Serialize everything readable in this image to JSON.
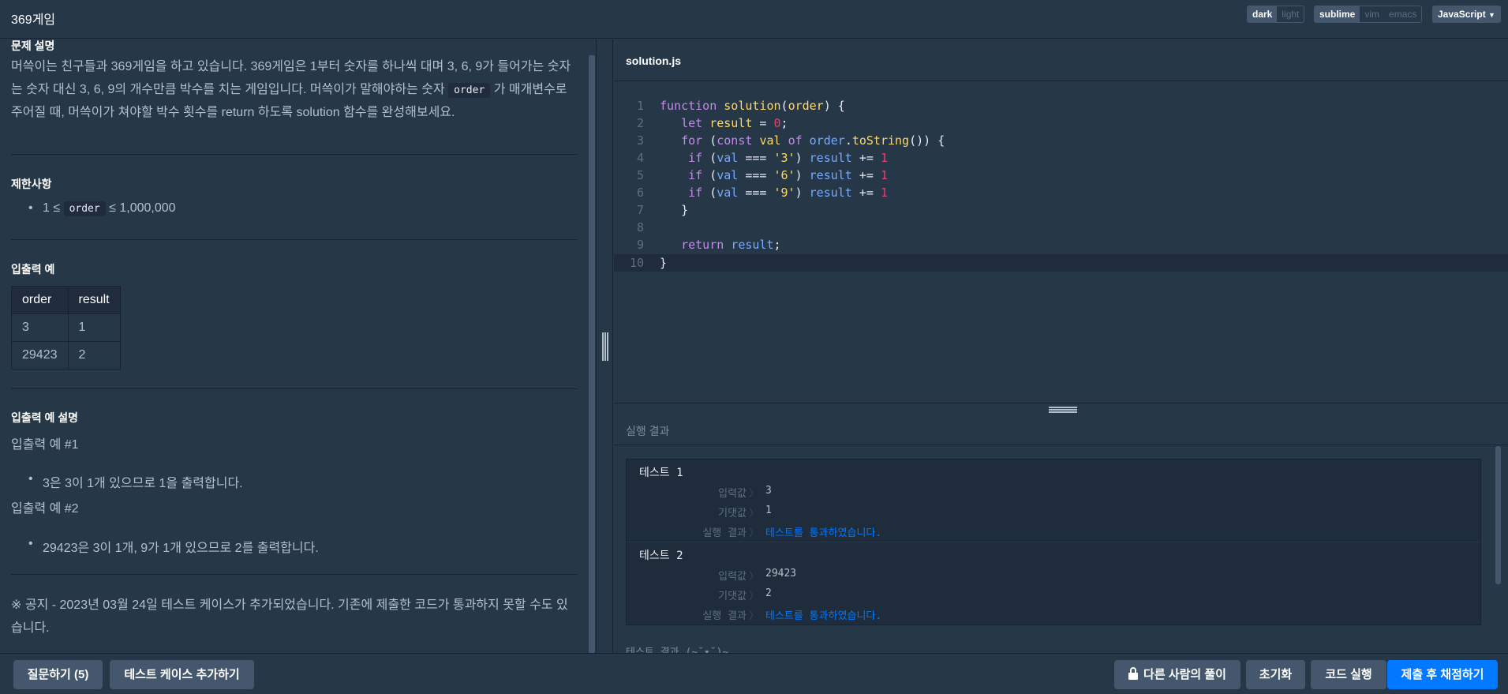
{
  "header": {
    "title": "369게임",
    "theme": [
      "dark",
      "light"
    ],
    "keymap": [
      "sublime",
      "vim",
      "emacs"
    ],
    "language": "JavaScript"
  },
  "problem": {
    "desc_title": "문제 설명",
    "desc_line1": "머쓱이는 친구들과 369게임을 하고 있습니다. 369게임은 1부터 숫자를 하나씩 대며 3, 6, 9가 들어가는 숫자",
    "desc_line2_a": "는 숫자 대신 3, 6, 9의 개수만큼 박수를 치는 게임입니다. 머쓱이가 말해야하는 숫자 ",
    "desc_code": "order",
    "desc_line2_b": " 가 매개변수로",
    "desc_line3": "주어질 때, 머쓱이가 쳐야할 박수 횟수를 return 하도록 solution 함수를 완성해보세요.",
    "limits_title": "제한사항",
    "limit_a": "1 ≤ ",
    "limit_code": "order",
    "limit_b": " ≤ 1,000,000",
    "io_title": "입출력 예",
    "io_headers": [
      "order",
      "result"
    ],
    "io_rows": [
      [
        "3",
        "1"
      ],
      [
        "29423",
        "2"
      ]
    ],
    "explain_title": "입출력 예 설명",
    "ex1_title": "입출력 예 #1",
    "ex1_item": "3은 3이 1개 있으므로 1을 출력합니다.",
    "ex2_title": "입출력 예 #2",
    "ex2_item": "29423은 3이 1개, 9가 1개 있으므로 2를 출력합니다.",
    "notice_line1": "※ 공지 - 2023년 03월 24일 테스트 케이스가 추가되었습니다. 기존에 제출한 코드가 통과하지 못할 수도 있",
    "notice_line2": "습니다."
  },
  "editor": {
    "filename": "solution.js",
    "line_numbers": [
      "1",
      "2",
      "3",
      "4",
      "5",
      "6",
      "7",
      "8",
      "9",
      "10"
    ]
  },
  "result": {
    "title": "실행 결과",
    "tests": [
      {
        "name": "테스트 1",
        "input_label": "입력값",
        "input": "3",
        "expected_label": "기댓값",
        "expected": "1",
        "result_label": "실행 결과",
        "result": "테스트를 통과하였습니다."
      },
      {
        "name": "테스트 2",
        "input_label": "입력값",
        "input": "29423",
        "expected_label": "기댓값",
        "expected": "2",
        "result_label": "실행 결과",
        "result": "테스트를 통과하였습니다."
      }
    ],
    "sep": "〉",
    "footer_note": "테스트 결과 (~˘▾˘)~"
  },
  "bottom": {
    "ask": "질문하기 (5)",
    "add_testcase": "테스트 케이스 추가하기",
    "others": "다른 사람의 풀이",
    "reset": "초기화",
    "run": "코드 실행",
    "submit": "제출 후 채점하기"
  },
  "colors": {
    "background": "#263747",
    "border": "#172334",
    "button": "#44576c",
    "primary": "#0078ff",
    "keyword": "#c589e8",
    "function": "#ffd866",
    "number": "#e83f6f",
    "variable": "#78a9ff"
  },
  "icons": [
    "lock-icon"
  ]
}
